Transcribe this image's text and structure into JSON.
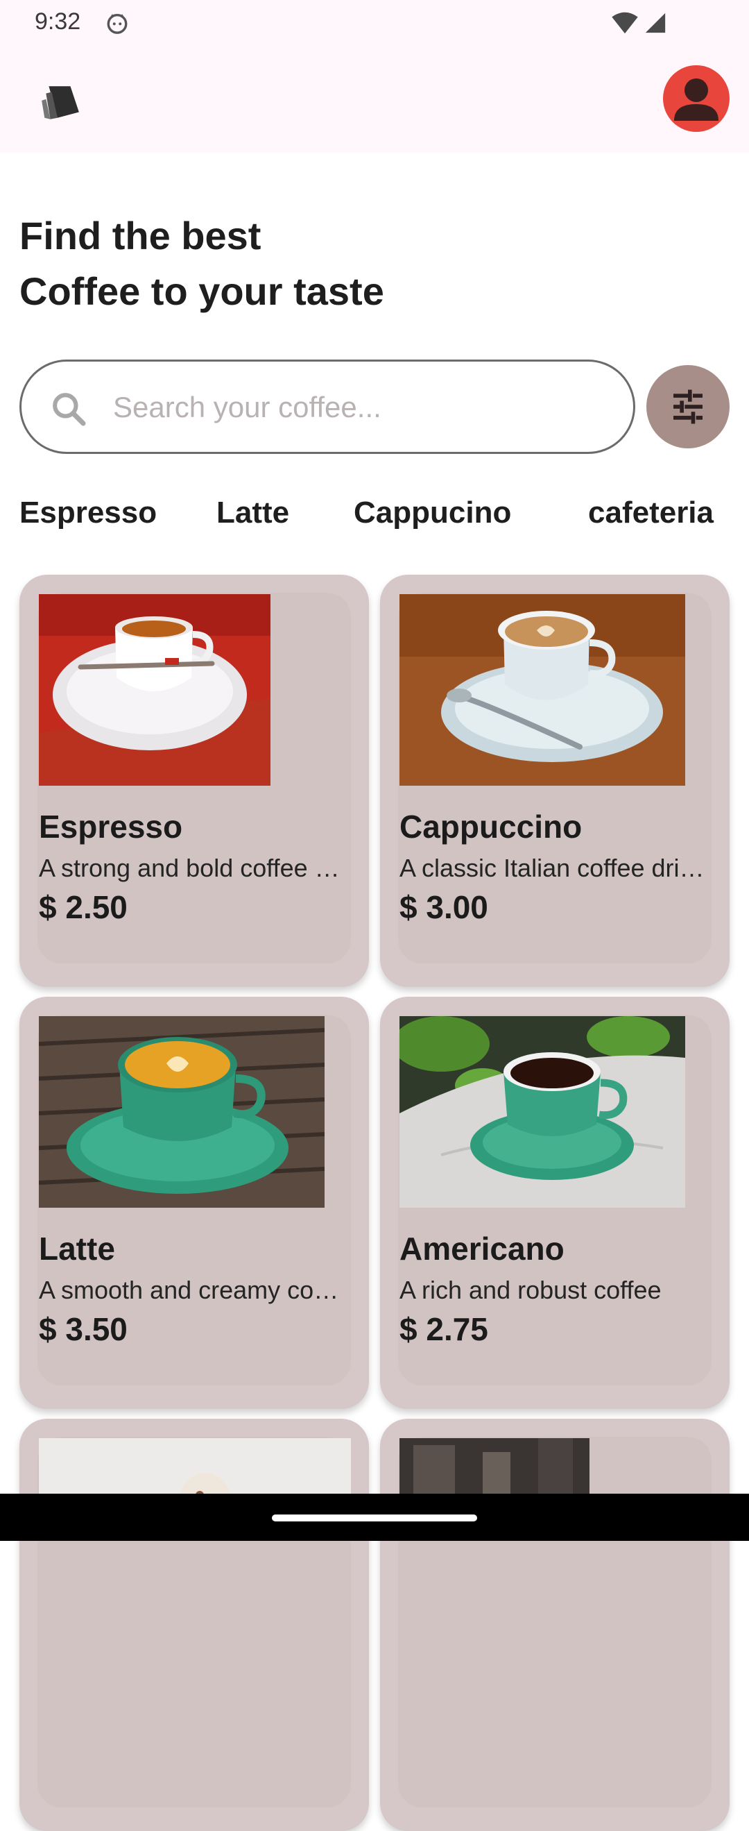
{
  "status_bar": {
    "time": "9:32"
  },
  "headline": {
    "line1": "Find the best",
    "line2": "Coffee to your taste"
  },
  "search": {
    "placeholder": "Search your coffee..."
  },
  "categories": [
    "Espresso",
    "Latte",
    "Cappucino",
    "cafeteria"
  ],
  "products": [
    {
      "name": "Espresso",
      "description": "A strong and bold coffee shot",
      "price": "$ 2.50"
    },
    {
      "name": "Cappuccino",
      "description": "A classic Italian coffee drink",
      "price": "$ 3.00"
    },
    {
      "name": "Latte",
      "description": "A smooth and creamy coffee",
      "price": "$ 3.50"
    },
    {
      "name": "Americano",
      "description": "A rich and robust coffee",
      "price": "$ 2.75"
    }
  ],
  "colors": {
    "accent": "#a78e88",
    "card": "#d6c8c8",
    "avatar": "#e8463c"
  }
}
